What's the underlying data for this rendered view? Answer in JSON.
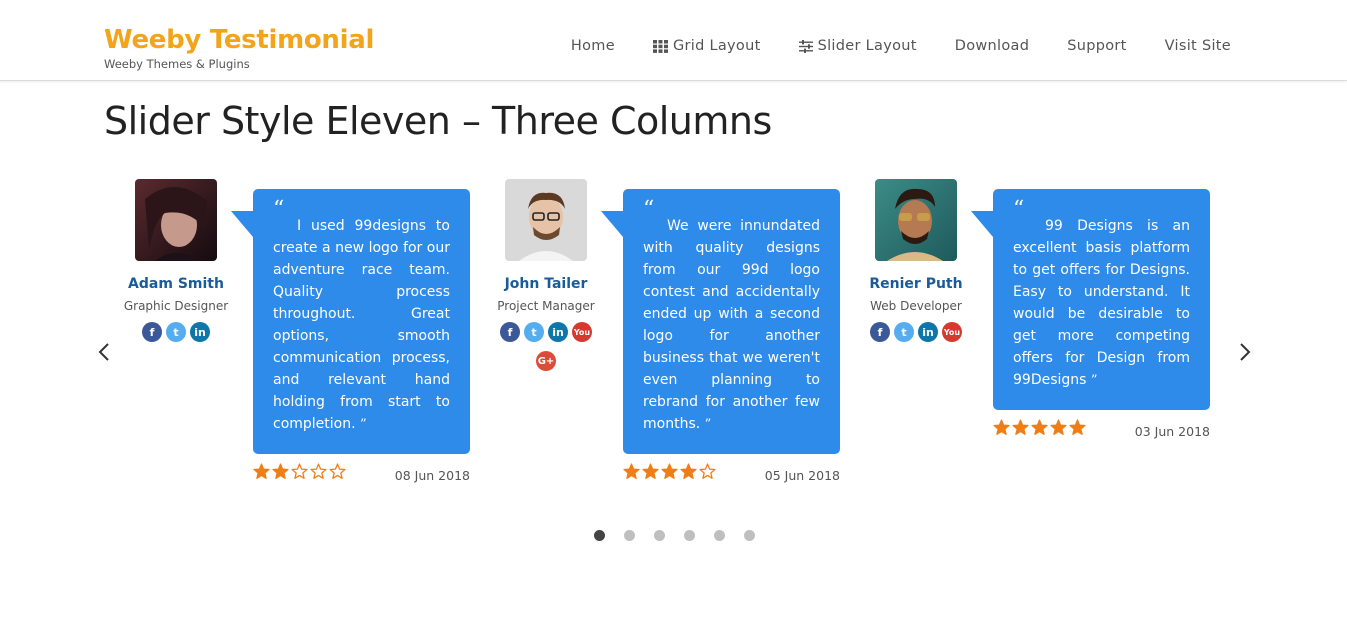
{
  "header": {
    "brand_title": "Weeby Testimonial",
    "brand_subtitle": "Weeby Themes & Plugins",
    "nav": [
      {
        "label": "Home",
        "icon": ""
      },
      {
        "label": "Grid Layout",
        "icon": "grid-icon"
      },
      {
        "label": "Slider Layout",
        "icon": "sliders-icon"
      },
      {
        "label": "Download",
        "icon": ""
      },
      {
        "label": "Support",
        "icon": ""
      },
      {
        "label": "Visit Site",
        "icon": ""
      }
    ]
  },
  "page": {
    "title": "Slider Style Eleven – Three Columns"
  },
  "colors": {
    "brand": "#f2a51a",
    "bubble": "#2f8bea",
    "name": "#1a5b9a",
    "star": "#f07e16"
  },
  "testimonials": [
    {
      "name": "Adam Smith",
      "role": "Graphic Designer",
      "socials": [
        "facebook",
        "twitter",
        "linkedin"
      ],
      "quote": "I used 99designs to create a new logo for our adventure race team. Quality process throughout. Great options, smooth communication process, and relevant hand holding from start to completion.",
      "rating": 2,
      "max_rating": 5,
      "date": "08 Jun 2018"
    },
    {
      "name": "John Tailer",
      "role": "Project Manager",
      "socials": [
        "facebook",
        "twitter",
        "linkedin",
        "youtube",
        "google-plus"
      ],
      "quote": "We were innundated with quality designs from our 99d logo contest and accidentally ended up with a second logo for another business that we weren't even planning to rebrand for another few months.",
      "rating": 4,
      "max_rating": 5,
      "date": "05 Jun 2018"
    },
    {
      "name": "Renier Puth",
      "role": "Web Developer",
      "socials": [
        "facebook",
        "twitter",
        "linkedin",
        "youtube"
      ],
      "quote": "99 Designs is an excellent basis platform to get offers for Designs. Easy to understand. It would be desirable to get more competing offers for Design from 99Designs",
      "rating": 5,
      "max_rating": 5,
      "date": "03 Jun 2018"
    }
  ],
  "pagination": {
    "pages": 6,
    "active": 1
  },
  "quote_marks": {
    "open": "“",
    "close": "”"
  },
  "social_glyphs": {
    "facebook": "f",
    "twitter": "t",
    "linkedin": "in",
    "youtube": "You",
    "google-plus": "G+"
  }
}
